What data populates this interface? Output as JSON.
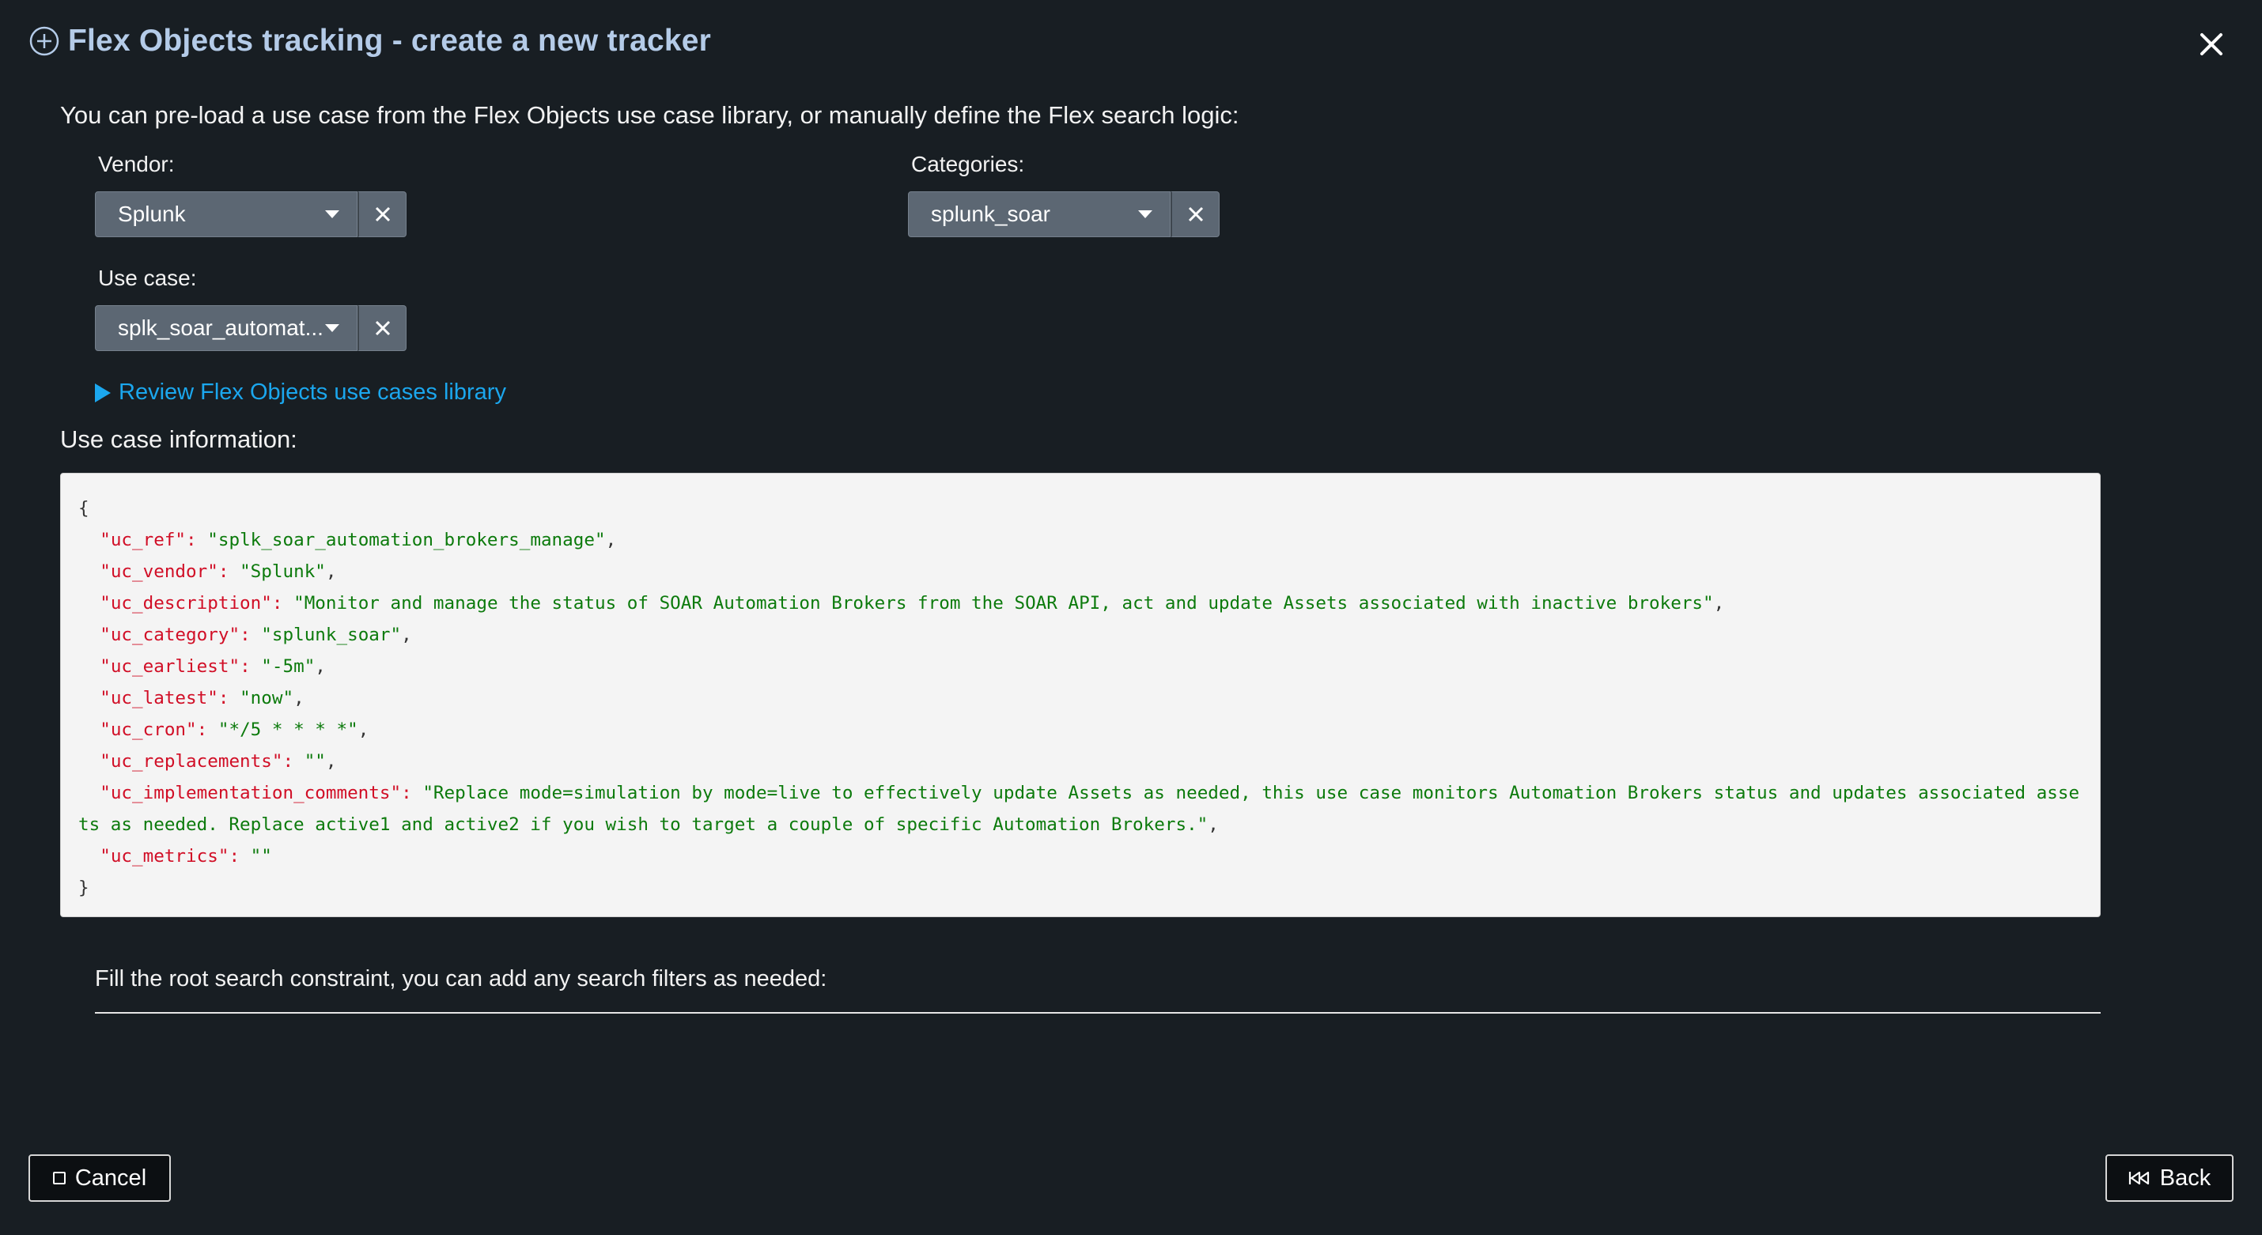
{
  "dialog": {
    "title": "Flex Objects tracking - create a new tracker",
    "title_icon": "plus-circle-icon",
    "close_icon": "close-icon"
  },
  "intro_text": "You can pre-load a use case from the Flex Objects use case library, or manually define the Flex search logic:",
  "vendor": {
    "label": "Vendor:",
    "value": "Splunk"
  },
  "categories": {
    "label": "Categories:",
    "value": "splunk_soar"
  },
  "use_case": {
    "label": "Use case:",
    "value": "splk_soar_automat..."
  },
  "library_link": "Review Flex Objects use cases library",
  "use_case_info_label": "Use case information:",
  "code": {
    "open": "{",
    "close": "}",
    "lines": [
      {
        "key": "\"uc_ref\"",
        "value": "\"splk_soar_automation_brokers_manage\"",
        "sep": ","
      },
      {
        "key": "\"uc_vendor\"",
        "value": "\"Splunk\"",
        "sep": ","
      },
      {
        "key": "\"uc_description\"",
        "value": "\"Monitor and manage the status of SOAR Automation Brokers from the SOAR API, act and update Assets associated with inactive brokers\"",
        "sep": ","
      },
      {
        "key": "\"uc_category\"",
        "value": "\"splunk_soar\"",
        "sep": ","
      },
      {
        "key": "\"uc_earliest\"",
        "value": "\"-5m\"",
        "sep": ","
      },
      {
        "key": "\"uc_latest\"",
        "value": "\"now\"",
        "sep": ","
      },
      {
        "key": "\"uc_cron\"",
        "value": "\"*/5 * * * *\"",
        "sep": ","
      },
      {
        "key": "\"uc_replacements\"",
        "value": "\"\"",
        "sep": ","
      },
      {
        "key": "\"uc_implementation_comments\"",
        "value": "\"Replace mode=simulation by mode=live to effectively update Assets as needed, this use case monitors Automation Brokers status and updates associated assets as needed. Replace active1 and active2 if you wish to target a couple of specific Automation Brokers.\"",
        "sep": ","
      },
      {
        "key": "\"uc_metrics\"",
        "value": "\"\"",
        "sep": ""
      }
    ]
  },
  "constraint_label": "Fill the root search constraint, you can add any search filters as needed:",
  "buttons": {
    "cancel": "Cancel",
    "back": "Back"
  },
  "colors": {
    "title": "#b4cbe8",
    "link": "#1ba7ee",
    "code_key": "#d10e26",
    "code_string": "#0c7a0c"
  }
}
